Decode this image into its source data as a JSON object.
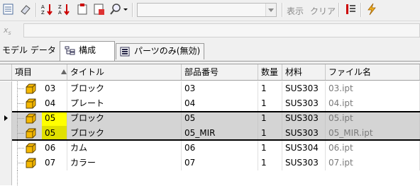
{
  "toolbar": {
    "icons": [
      "bom-icon",
      "eraser-icon",
      "sort-ascending-icon",
      "sort-descending-icon",
      "clipboard-icon",
      "export-icon",
      "find-icon",
      "chevron-down-icon",
      "color-icon",
      "lightning-icon"
    ],
    "filter_value": "",
    "show_label": "表示",
    "clear_label": "クリア"
  },
  "formula": {
    "fx_label": "x",
    "fx_sub": "s",
    "value": ""
  },
  "tabs": [
    {
      "label": "モデル データ",
      "active": false
    },
    {
      "label": "構成",
      "active": true
    },
    {
      "label": "パーツのみ(無効)",
      "active": false
    }
  ],
  "grid": {
    "columns": [
      "項目",
      "タイトル",
      "部品番号",
      "数量",
      "材料",
      "ファイル名"
    ],
    "rows": [
      {
        "item": "03",
        "title": "ブロック",
        "part": "03",
        "qty": "1",
        "material": "SUS303",
        "file": "03.ipt",
        "selected": false,
        "highlight": false
      },
      {
        "item": "04",
        "title": "プレート",
        "part": "04",
        "qty": "1",
        "material": "SUS303",
        "file": "04.ipt",
        "selected": false,
        "highlight": false
      },
      {
        "item": "05",
        "title": "ブロック",
        "part": "05",
        "qty": "1",
        "material": "SUS303",
        "file": "05.ipt",
        "selected": true,
        "highlight": true,
        "highlight_color": "#ffff00"
      },
      {
        "item": "05",
        "title": "ブロック",
        "part": "05_MIR",
        "qty": "1",
        "material": "SUS303",
        "file": "05_MIR.ipt",
        "selected": true,
        "highlight": true,
        "highlight_color": "#e0e000"
      },
      {
        "item": "06",
        "title": "カム",
        "part": "06",
        "qty": "1",
        "material": "SUS304",
        "file": "06.ipt",
        "selected": false,
        "highlight": false
      },
      {
        "item": "07",
        "title": "カラー",
        "part": "07",
        "qty": "1",
        "material": "SUS303",
        "file": "07.ipt",
        "selected": false,
        "highlight": false
      }
    ]
  },
  "colors": {
    "highlight_yellow": "#ffff00",
    "highlight_olive": "#e0e000",
    "selected_row": "#d4d4d4",
    "part_icon": "#f5b800"
  }
}
